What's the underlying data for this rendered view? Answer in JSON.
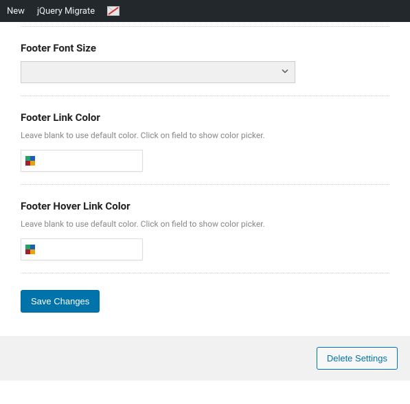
{
  "adminbar": {
    "new": "New",
    "jquery_migrate": "jQuery Migrate"
  },
  "sections": {
    "font_size": {
      "title": "Footer Font Size",
      "value": ""
    },
    "link_color": {
      "title": "Footer Link Color",
      "desc": "Leave blank to use default color. Click on field to show color picker.",
      "value": ""
    },
    "hover_color": {
      "title": "Footer Hover Link Color",
      "desc": "Leave blank to use default color. Click on field to show color picker.",
      "value": ""
    }
  },
  "buttons": {
    "save": "Save Changes",
    "delete": "Delete Settings"
  }
}
